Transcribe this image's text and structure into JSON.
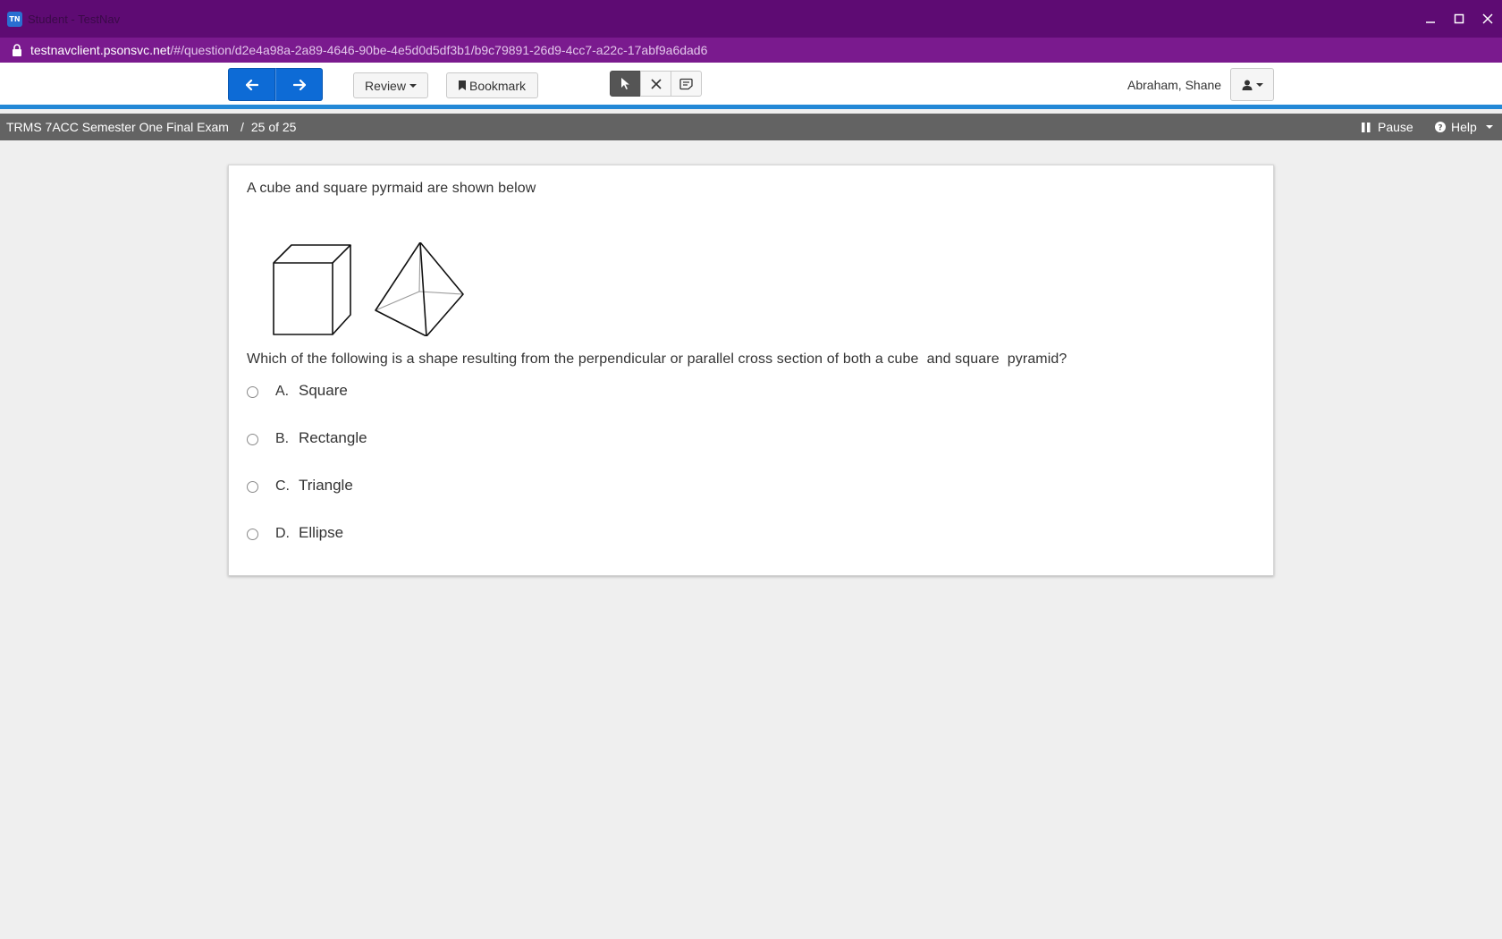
{
  "window": {
    "logo_text": "TN",
    "title": "Student - TestNav"
  },
  "address": {
    "host": "testnavclient.psonsvc.net",
    "path": "/#/question/d2e4a98a-2a89-4646-90be-4e5d0d5df3b1/b9c79891-26d9-4cc7-a22c-17abf9a6dad6"
  },
  "toolbar": {
    "review_label": "Review",
    "bookmark_label": "Bookmark",
    "user_name": "Abraham, Shane"
  },
  "exam": {
    "title": "TRMS 7ACC Semester One Final Exam",
    "separator": "/",
    "progress": "25 of 25",
    "pause_label": "Pause",
    "help_label": "Help"
  },
  "question": {
    "intro": "A cube and square pyrmaid are shown below",
    "prompt": "Which of the following is a shape resulting from the perpendicular or parallel cross section of both a cube  and square  pyramid?",
    "choices": [
      {
        "letter": "A.",
        "text": "Square"
      },
      {
        "letter": "B.",
        "text": "Rectangle"
      },
      {
        "letter": "C.",
        "text": "Triangle"
      },
      {
        "letter": "D.",
        "text": "Ellipse"
      }
    ]
  },
  "colors": {
    "titlebar": "#5e0b73",
    "addressbar": "#7a1a8e",
    "nav_button": "#0d6bd6",
    "toolbar_accent": "#2388d6",
    "exambar": "#636363"
  }
}
